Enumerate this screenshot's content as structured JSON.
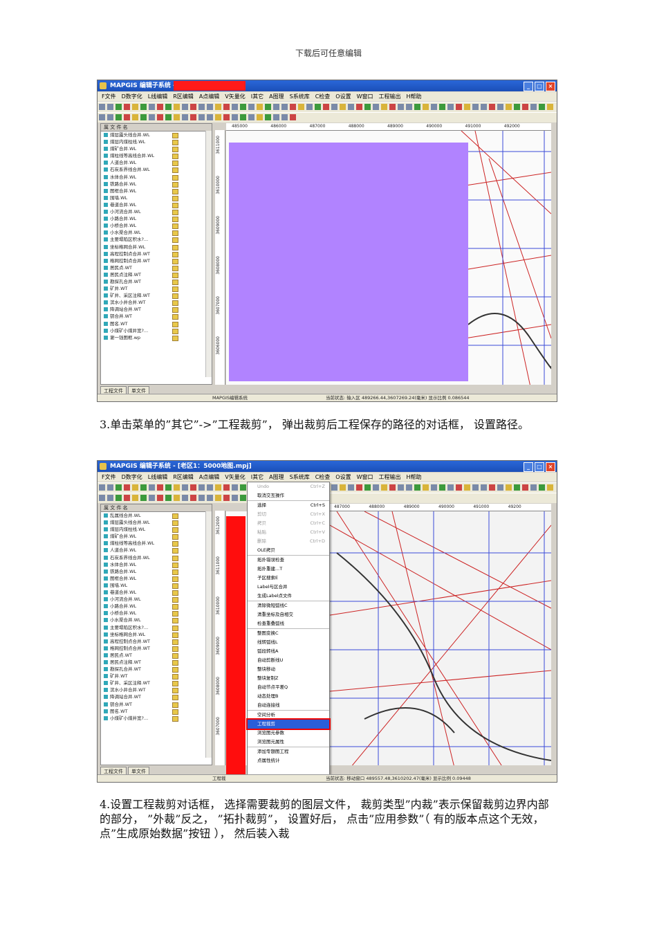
{
  "header_note": "下载后可任意编辑",
  "shot1": {
    "title": "MAPGIS 编辑子系统 -",
    "menu": [
      "F文件",
      "D数字化",
      "L线编辑",
      "R区编辑",
      "A点编辑",
      "V矢量化",
      "I其它",
      "A图理",
      "S系统库",
      "C检查",
      "O设置",
      "W窗口",
      "工程输出",
      "H帮助"
    ],
    "panel_header": "属  文 件 名",
    "layers": [
      "煤层露头线合并.WL",
      "煤层内煤柱线.WL",
      "煤矿合并.WL",
      "煤柱线等高线合并.WL",
      "人道合并.WL",
      "石炭系界线合并.WL",
      "水体合并.WL",
      "铁路合并.WL",
      "图框合并.WL",
      "围墙.WL",
      "巷道合并.WL",
      "小河流合并.WL",
      "小路合并.WL",
      "小桥合并.WL",
      "小水渠合并.WL",
      "主要塌陷区积水?...",
      "坐标格网合并.WL",
      "高程控制点合并.WT",
      "格网控制点合并.WT",
      "居民点.WT",
      "居民点注释.WT",
      "勘探孔合并.WT",
      "矿井.WT",
      "矿井、采区注释.WT",
      "滨水小井合并.WT",
      "降调站合并.WT",
      "钥合并.WT",
      "图名.WT",
      "小煤矿小煤井宽?...",
      "谢一钱图框.wp"
    ],
    "tabs": [
      "工程文件",
      "单文件"
    ],
    "x_ticks": [
      "485000",
      "486000",
      "487000",
      "488000",
      "489000",
      "490000",
      "491000",
      "492000"
    ],
    "y_ticks": [
      "3611000",
      "3610000",
      "3609000",
      "3608000",
      "3607000",
      "3606000"
    ],
    "status_left": "MAPGIS编辑系统",
    "status_right": "当前状态: 输入区  489266.44,3607269.24(毫米)  显示比例 0.086544"
  },
  "para1": "3.单击菜单的”其它”->”工程裁剪”， 弹出裁剪后工程保存的路径的对话框， 设置路径。",
  "shot2": {
    "title": "MAPGIS 编辑子系统 - [老区1：5000地图.mpj]",
    "menu": [
      "F文件",
      "D数字化",
      "L线编辑",
      "R区编辑",
      "A点编辑",
      "V矢量化",
      "I其它",
      "A图理",
      "S系统库",
      "C检查",
      "O设置",
      "W窗口",
      "工程输出",
      "H帮助"
    ],
    "panel_header": "属  文 件 名",
    "layers": [
      "乱属线合并.WL",
      "煤层露头线合并.WL",
      "煤层内煤柱线.WL",
      "煤矿合并.WL",
      "煤柱线等高线合并.WL",
      "人道合并.WL",
      "石炭系界线合并.WL",
      "水体合并.WL",
      "铁路合并.WL",
      "图框合并.WL",
      "围墙.WL",
      "巷道合并.WL",
      "小河流合并.WL",
      "小路合并.WL",
      "小桥合并.WL",
      "小水渠合并.WL",
      "主要塌陷区积水?...",
      "坐标格网合并.WL",
      "高程控制点合并.WT",
      "格网控制点合并.WT",
      "居民点.WT",
      "居民点注释.WT",
      "勘探孔合并.WT",
      "矿井.WT",
      "矿井、采区注释.WT",
      "滨水小井合并.WT",
      "降调站合并.WT",
      "钥合并.WT",
      "图名.WT",
      "小煤矿小煤井宽?..."
    ],
    "menu_items": [
      {
        "label": "Undo",
        "key": "Ctrl+Z",
        "state": "dis"
      },
      {
        "label": "取消交互操作",
        "key": "",
        "state": ""
      },
      {
        "label": "选择",
        "key": "Ctrl+S",
        "state": "sep"
      },
      {
        "label": "剪切",
        "key": "Ctrl+X",
        "state": "dis"
      },
      {
        "label": "拷贝",
        "key": "Ctrl+C",
        "state": "dis"
      },
      {
        "label": "粘贴",
        "key": "Ctrl+V",
        "state": "dis"
      },
      {
        "label": "删除",
        "key": "Ctrl+D",
        "state": "dis"
      },
      {
        "label": "OLE拷贝",
        "key": "",
        "state": ""
      },
      {
        "label": "拓扑错误检查",
        "key": "",
        "state": "sep"
      },
      {
        "label": "拓扑重建...T",
        "key": "",
        "state": ""
      },
      {
        "label": "子区搜索E",
        "key": "",
        "state": ""
      },
      {
        "label": "Label与区合并",
        "key": "",
        "state": ""
      },
      {
        "label": "生成Label点文件",
        "key": "",
        "state": ""
      },
      {
        "label": "清除微短弧线C",
        "key": "",
        "state": "sep"
      },
      {
        "label": "清重坐标及自相交",
        "key": "",
        "state": ""
      },
      {
        "label": "检查重叠弧线",
        "key": "",
        "state": ""
      },
      {
        "label": "整图变换C",
        "key": "",
        "state": "sep"
      },
      {
        "label": "线转弧线L",
        "key": "",
        "state": ""
      },
      {
        "label": "弧段转线A",
        "key": "",
        "state": ""
      },
      {
        "label": "自动剪断线U",
        "key": "",
        "state": ""
      },
      {
        "label": "整块移动",
        "key": "",
        "state": ""
      },
      {
        "label": "整块复制Z",
        "key": "",
        "state": ""
      },
      {
        "label": "自动节点平差Q",
        "key": "",
        "state": ""
      },
      {
        "label": "动态处理B",
        "key": "",
        "state": ""
      },
      {
        "label": "自动连接线",
        "key": "",
        "state": ""
      },
      {
        "label": "空间分析",
        "key": "",
        "state": "sep"
      },
      {
        "label": "工程裁剪",
        "key": "",
        "state": "sel"
      },
      {
        "label": "浏览图元参数",
        "key": "",
        "state": ""
      },
      {
        "label": "浏览图元属性",
        "key": "",
        "state": ""
      },
      {
        "label": "添加专题图工程",
        "key": "",
        "state": "sep"
      },
      {
        "label": "点属性统计",
        "key": "",
        "state": ""
      }
    ],
    "tabs": [
      "工程文件",
      "单文件"
    ],
    "x_ticks": [
      "487000",
      "488000",
      "489000",
      "490000",
      "491000",
      "49200"
    ],
    "y_ticks": [
      "3612000",
      "3611000",
      "3610000",
      "3609000",
      "3608000",
      "3607000"
    ],
    "status_left": "工程裁",
    "status_right": "当前状态: 移动窗口  489557.48,3610202.47(毫米)  显示比例 0.09448"
  },
  "para2": "4.设置工程裁剪对话框， 选择需要裁剪的图层文件， 裁剪类型”内裁”表示保留裁剪边界内部的部分， ”外裁”反之， ”拓扑裁剪”， 设置好后， 点击”应用参数”（ 有的版本点这个无效， 点”生成原始数据”按钮 ）， 然后装入裁"
}
